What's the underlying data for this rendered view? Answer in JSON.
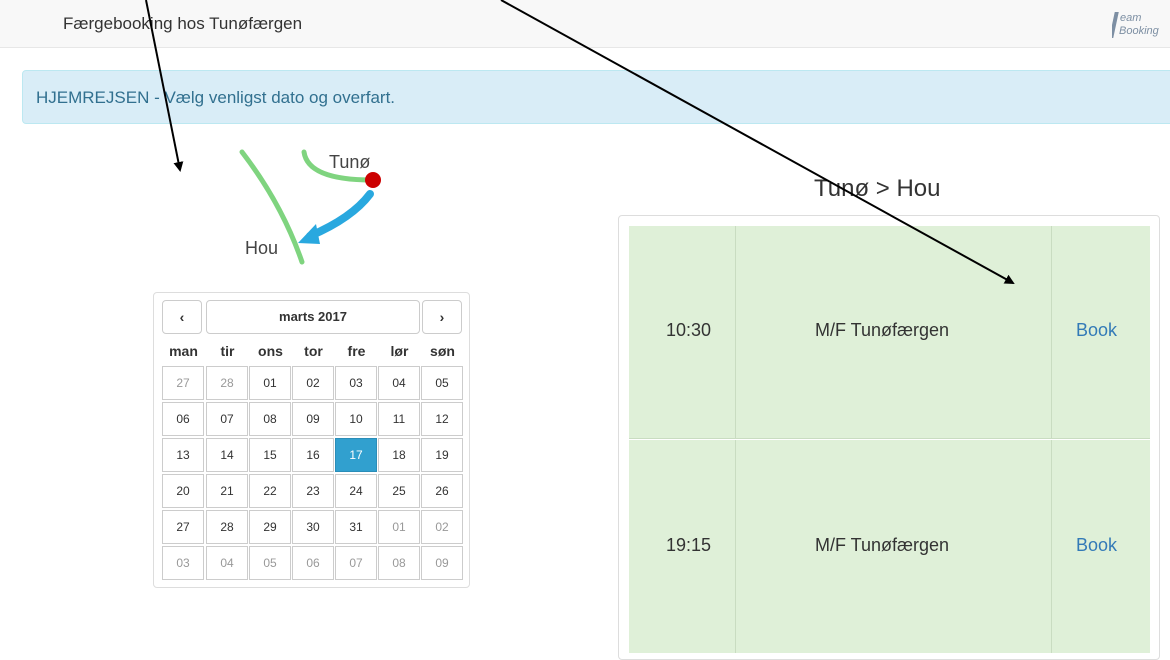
{
  "header": {
    "title": "Færgebooking hos Tunøfærgen",
    "logo_line1": "eam",
    "logo_line2": "Booking"
  },
  "alert": {
    "text": "HJEMREJSEN - Vælg venligst dato og overfart."
  },
  "route_graphic": {
    "origin": "Tunø",
    "destination": "Hou"
  },
  "calendar": {
    "prev_label": "‹",
    "title": "marts 2017",
    "next_label": "›",
    "weekdays": [
      "man",
      "tir",
      "ons",
      "tor",
      "fre",
      "lør",
      "søn"
    ],
    "weeks": [
      [
        "27",
        "28",
        "01",
        "02",
        "03",
        "04",
        "05"
      ],
      [
        "06",
        "07",
        "08",
        "09",
        "10",
        "11",
        "12"
      ],
      [
        "13",
        "14",
        "15",
        "16",
        "17",
        "18",
        "19"
      ],
      [
        "20",
        "21",
        "22",
        "23",
        "24",
        "25",
        "26"
      ],
      [
        "27",
        "28",
        "29",
        "30",
        "31",
        "01",
        "02"
      ],
      [
        "03",
        "04",
        "05",
        "06",
        "07",
        "08",
        "09"
      ]
    ],
    "selected": "17"
  },
  "departures": {
    "title": "Tunø > Hou",
    "rows": [
      {
        "time": "10:30",
        "ship": "M/F Tunøfærgen",
        "action": "Book"
      },
      {
        "time": "19:15",
        "ship": "M/F Tunøfærgen",
        "action": "Book"
      }
    ]
  },
  "colors": {
    "alert_bg": "#d9edf7",
    "alert_text": "#31708f",
    "row_bg": "#dff0d8",
    "link": "#337ab7",
    "selected_day": "#31a0cf",
    "route_line": "#7fd47f",
    "route_arrow": "#29a8df",
    "route_dot": "#cc0000"
  }
}
